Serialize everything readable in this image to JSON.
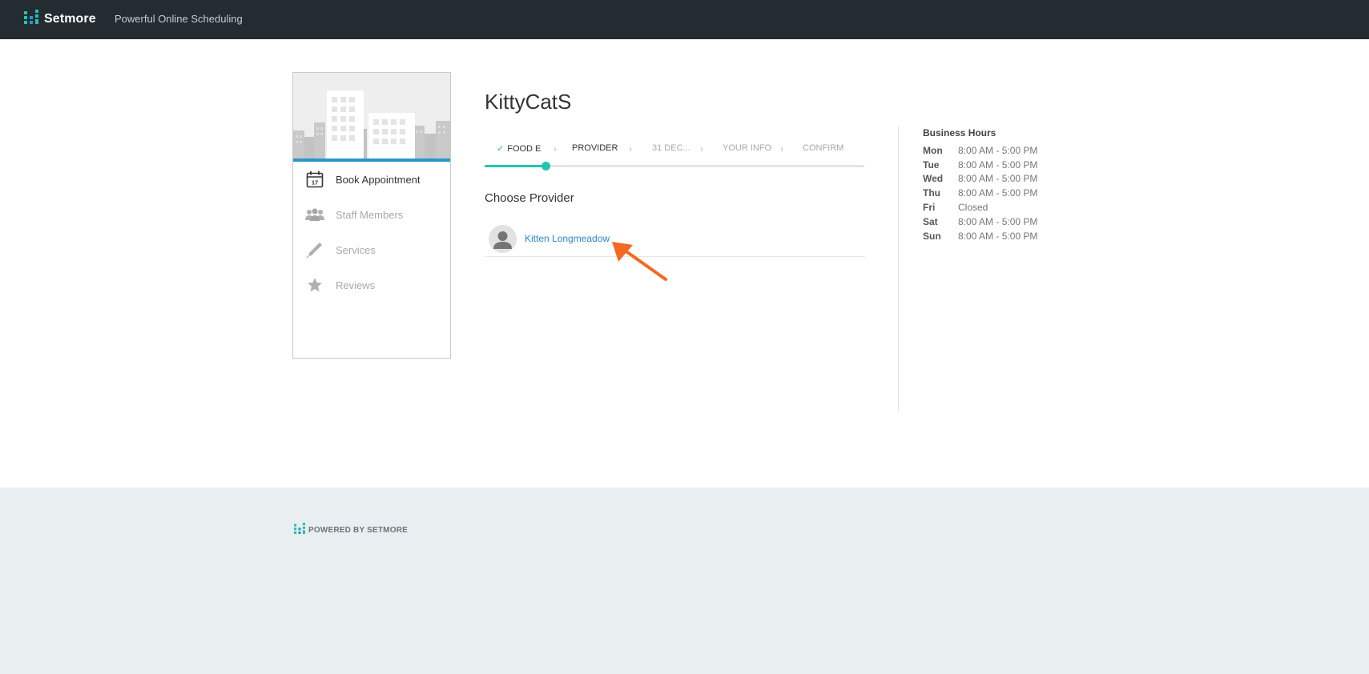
{
  "topbar": {
    "brand": "Setmore",
    "tagline": "Powerful Online Scheduling",
    "bg_color": "#242b31",
    "logo_icon": "setmore-logo-icon"
  },
  "sidebar": {
    "items": [
      {
        "label": "Book Appointment",
        "icon": "calendar-icon",
        "calendar_day": "17",
        "active": true
      },
      {
        "label": "Staff Members",
        "icon": "staff-group-icon",
        "active": false
      },
      {
        "label": "Services",
        "icon": "pen-icon",
        "active": false
      },
      {
        "label": "Reviews",
        "icon": "star-icon",
        "active": false
      }
    ],
    "accent_color": "#2b95cc"
  },
  "main": {
    "business_name": "KittyCatS",
    "steps": [
      {
        "label": "FOOD E",
        "state": "done"
      },
      {
        "label": "PROVIDER",
        "state": "current"
      },
      {
        "label": "31 DEC...",
        "state": "pending"
      },
      {
        "label": "YOUR INFO",
        "state": "pending"
      },
      {
        "label": "CONFIRM",
        "state": "pending"
      }
    ],
    "progress_fraction": 0.16,
    "progress_color": "#22c3b1",
    "section_title": "Choose Provider",
    "providers": [
      {
        "name": "Kitten Longmeadow",
        "icon": "user-avatar-icon"
      }
    ],
    "annotation_arrow_color": "#f26a21"
  },
  "business_hours": {
    "title": "Business Hours",
    "days": [
      {
        "day": "Mon",
        "time": "8:00 AM - 5:00 PM"
      },
      {
        "day": "Tue",
        "time": "8:00 AM - 5:00 PM"
      },
      {
        "day": "Wed",
        "time": "8:00 AM - 5:00 PM"
      },
      {
        "day": "Thu",
        "time": "8:00 AM - 5:00 PM"
      },
      {
        "day": "Fri",
        "time": "Closed"
      },
      {
        "day": "Sat",
        "time": "8:00 AM - 5:00 PM"
      },
      {
        "day": "Sun",
        "time": "8:00 AM - 5:00 PM"
      }
    ]
  },
  "footer": {
    "powered_by": "POWERED BY SETMORE",
    "bg_color": "#e9eef1"
  }
}
